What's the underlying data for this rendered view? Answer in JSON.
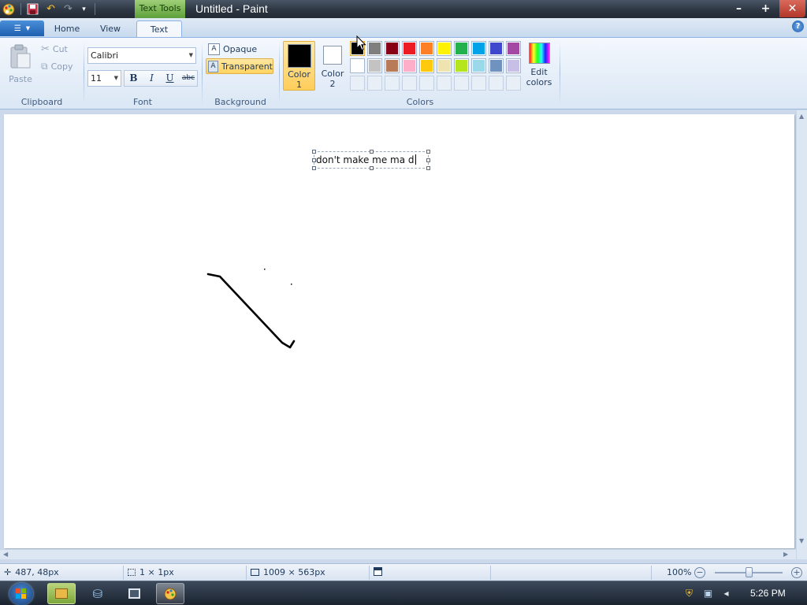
{
  "window": {
    "title": "Untitled - Paint",
    "contextual_tab_label": "Text Tools",
    "controls": {
      "minimize": "–",
      "maximize": "+",
      "close": "✕"
    }
  },
  "quick_access": [
    "save-icon",
    "undo-icon",
    "redo-icon",
    "customize-icon"
  ],
  "tabs": [
    {
      "label": "Home",
      "active": false
    },
    {
      "label": "View",
      "active": false
    },
    {
      "label": "Text",
      "active": true
    }
  ],
  "ribbon": {
    "clipboard": {
      "label": "Clipboard",
      "paste": "Paste",
      "cut": "Cut",
      "copy": "Copy"
    },
    "font": {
      "label": "Font",
      "family": "Calibri",
      "size": "11",
      "bold": "B",
      "italic": "I",
      "underline": "U",
      "strikethrough": "abc"
    },
    "background": {
      "label": "Background",
      "opaque": "Opaque",
      "transparent": "Transparent",
      "selected": "transparent"
    },
    "colors": {
      "label": "Colors",
      "color1_label": "Color",
      "color1_num": "1",
      "color1_value": "#000000",
      "color2_label": "Color",
      "color2_num": "2",
      "color2_value": "#ffffff",
      "edit_label": "Edit",
      "edit_label2": "colors",
      "palette_row1": [
        "#000000",
        "#7f7f7f",
        "#880015",
        "#ed1c24",
        "#ff7f27",
        "#fff200",
        "#22b14c",
        "#00a2e8",
        "#3f48cc",
        "#a349a4"
      ],
      "palette_row2": [
        "#ffffff",
        "#c3c3c3",
        "#b97a57",
        "#ffaec9",
        "#ffc90e",
        "#efe4b0",
        "#b5e61d",
        "#99d9ea",
        "#7092be",
        "#c8bfe7"
      ]
    }
  },
  "canvas": {
    "text_content": "don't make me ma d"
  },
  "status": {
    "cursor_pos": "487, 48px",
    "selection_size": "1 × 1px",
    "image_size": "1009 × 563px",
    "zoom": "100%"
  },
  "taskbar": {
    "clock": "5:26 PM"
  }
}
